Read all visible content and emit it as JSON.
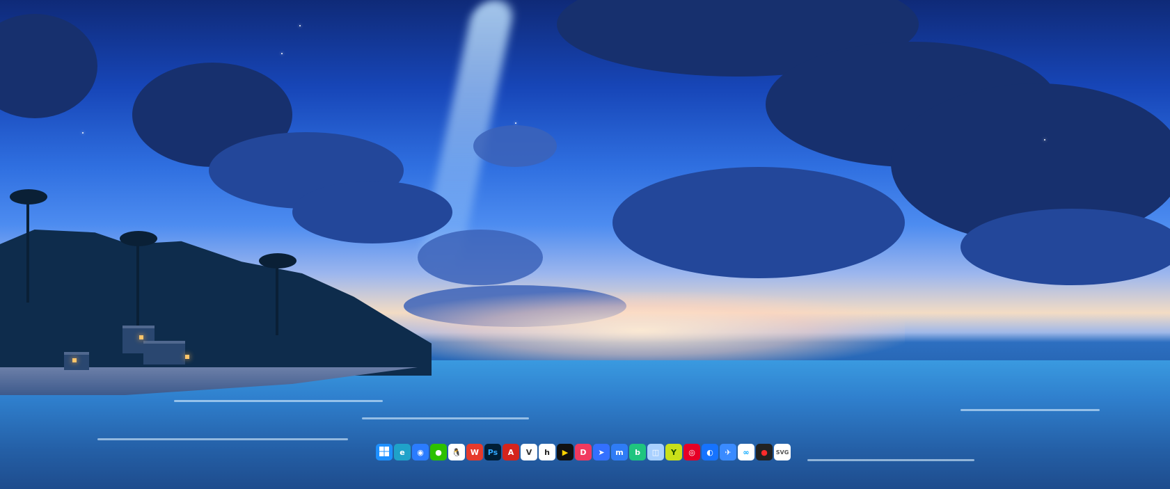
{
  "desktop": {
    "wallpaper": "night-beach-sky",
    "accent": "#1746b8"
  },
  "taskbar": {
    "apps": [
      {
        "name": "start-menu",
        "icon": "windows-logo-icon",
        "glyph": "",
        "bg": "#1e90ff",
        "fg": "#ffffff"
      },
      {
        "name": "edge",
        "icon": "edge-icon",
        "glyph": "e",
        "bg": "#1fa2c9",
        "fg": "#ffffff"
      },
      {
        "name": "browser-blue",
        "icon": "circle-browser-icon",
        "glyph": "◉",
        "bg": "#2b7cff",
        "fg": "#ffffff"
      },
      {
        "name": "wechat",
        "icon": "wechat-icon",
        "glyph": "●",
        "bg": "#2dc100",
        "fg": "#ffffff"
      },
      {
        "name": "qq",
        "icon": "qq-penguin-icon",
        "glyph": "🐧",
        "bg": "#ffffff",
        "fg": "#000000"
      },
      {
        "name": "wps",
        "icon": "wps-icon",
        "glyph": "W",
        "bg": "#e63a2b",
        "fg": "#ffffff"
      },
      {
        "name": "photoshop",
        "icon": "photoshop-icon",
        "glyph": "Ps",
        "bg": "#001e36",
        "fg": "#31a8ff"
      },
      {
        "name": "acrobat",
        "icon": "acrobat-icon",
        "glyph": "A",
        "bg": "#d4241c",
        "fg": "#ffffff"
      },
      {
        "name": "app-v",
        "icon": "v-app-icon",
        "glyph": "V",
        "bg": "#ffffff",
        "fg": "#333333"
      },
      {
        "name": "app-h",
        "icon": "h-app-icon",
        "glyph": "h",
        "bg": "#ffffff",
        "fg": "#222222"
      },
      {
        "name": "player",
        "icon": "play-icon",
        "glyph": "▶",
        "bg": "#111111",
        "fg": "#ffd400"
      },
      {
        "name": "app-d",
        "icon": "d-app-icon",
        "glyph": "D",
        "bg": "#f03a5f",
        "fg": "#ffffff"
      },
      {
        "name": "feishu",
        "icon": "feishu-icon",
        "glyph": "➤",
        "bg": "#3370ff",
        "fg": "#ffffff"
      },
      {
        "name": "app-m",
        "icon": "m-app-icon",
        "glyph": "m",
        "bg": "#2f7cf6",
        "fg": "#ffffff"
      },
      {
        "name": "app-b",
        "icon": "b-app-icon",
        "glyph": "b",
        "bg": "#1fc47f",
        "fg": "#ffffff"
      },
      {
        "name": "bottle",
        "icon": "bottle-icon",
        "glyph": "◫",
        "bg": "#a8d0ff",
        "fg": "#ffffff"
      },
      {
        "name": "app-y",
        "icon": "y-app-icon",
        "glyph": "Y",
        "bg": "#c9e01a",
        "fg": "#1a4a00"
      },
      {
        "name": "netease-music",
        "icon": "music-icon",
        "glyph": "◎",
        "bg": "#e60026",
        "fg": "#ffffff"
      },
      {
        "name": "app-swirl",
        "icon": "swirl-icon",
        "glyph": "◐",
        "bg": "#1673ff",
        "fg": "#ffffff"
      },
      {
        "name": "app-bird",
        "icon": "bird-icon",
        "glyph": "✈",
        "bg": "#3a8bff",
        "fg": "#ffffff"
      },
      {
        "name": "baidu-netdisk",
        "icon": "cloud-icon",
        "glyph": "∞",
        "bg": "#ffffff",
        "fg": "#06a7ff"
      },
      {
        "name": "recorder",
        "icon": "record-icon",
        "glyph": "●",
        "bg": "#222222",
        "fg": "#ff2b2b"
      },
      {
        "name": "svg-app",
        "icon": "svg-icon",
        "glyph": "SVG",
        "bg": "#ffffff",
        "fg": "#555555"
      }
    ]
  }
}
